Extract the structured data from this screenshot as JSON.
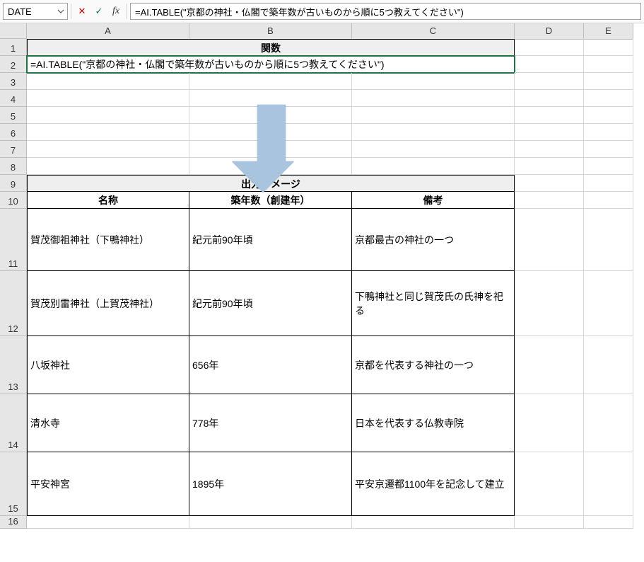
{
  "formula_bar": {
    "name_box": "DATE",
    "cancel": "✕",
    "enter": "✓",
    "fx": "fx",
    "formula": "=AI.TABLE(\"京都の神社・仏閣で築年数が古いものから順に5つ教えてください\")"
  },
  "columns": [
    "A",
    "B",
    "C",
    "D",
    "E"
  ],
  "rows": [
    "1",
    "2",
    "3",
    "4",
    "5",
    "6",
    "7",
    "8",
    "9",
    "10",
    "11",
    "12",
    "13",
    "14",
    "15",
    "16"
  ],
  "r1": {
    "header": "関数"
  },
  "r2": {
    "formula": "=AI.TABLE(\"京都の神社・仏閣で築年数が古いものから順に5つ教えてください\")"
  },
  "r9": {
    "header": "出力イメージ"
  },
  "r10": {
    "c1": "名称",
    "c2": "築年数（創建年）",
    "c3": "備考"
  },
  "data": [
    {
      "name": "賀茂御祖神社（下鴨神社）",
      "year": "紀元前90年頃",
      "note": "京都最古の神社の一つ"
    },
    {
      "name": "賀茂別雷神社（上賀茂神社）",
      "year": "紀元前90年頃",
      "note": "下鴨神社と同じ賀茂氏の氏神を祀る"
    },
    {
      "name": "八坂神社",
      "year": "656年",
      "note": "京都を代表する神社の一つ"
    },
    {
      "name": "清水寺",
      "year": "778年",
      "note": "日本を代表する仏教寺院"
    },
    {
      "name": "平安神宮",
      "year": "1895年",
      "note": "平安京遷都1100年を記念して建立"
    }
  ]
}
